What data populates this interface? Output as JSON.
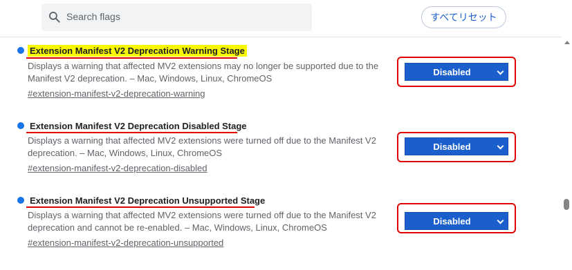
{
  "header": {
    "search_placeholder": "Search flags",
    "reset_label": "すべてリセット"
  },
  "flags": [
    {
      "title": "Extension Manifest V2 Deprecation Warning Stage",
      "description": "Displays a warning that affected MV2 extensions may no longer be supported due to the Manifest V2 deprecation. – Mac, Windows, Linux, ChromeOS",
      "link": "#extension-manifest-v2-deprecation-warning",
      "value": "Disabled",
      "highlighted": true
    },
    {
      "title": "Extension Manifest V2 Deprecation Disabled Stage",
      "description": "Displays a warning that affected MV2 extensions were turned off due to the Manifest V2 deprecation. – Mac, Windows, Linux, ChromeOS",
      "link": "#extension-manifest-v2-deprecation-disabled",
      "value": "Disabled",
      "highlighted": false
    },
    {
      "title": "Extension Manifest V2 Deprecation Unsupported Stage",
      "description": "Displays a warning that affected MV2 extensions were turned off due to the Manifest V2 deprecation and cannot be re-enabled. – Mac, Windows, Linux, ChromeOS",
      "link": "#extension-manifest-v2-deprecation-unsupported",
      "value": "Disabled",
      "highlighted": false
    }
  ],
  "colors": {
    "accent": "#1a5fcc",
    "annotation_red": "#e00000",
    "highlight_yellow": "#f8f800"
  }
}
